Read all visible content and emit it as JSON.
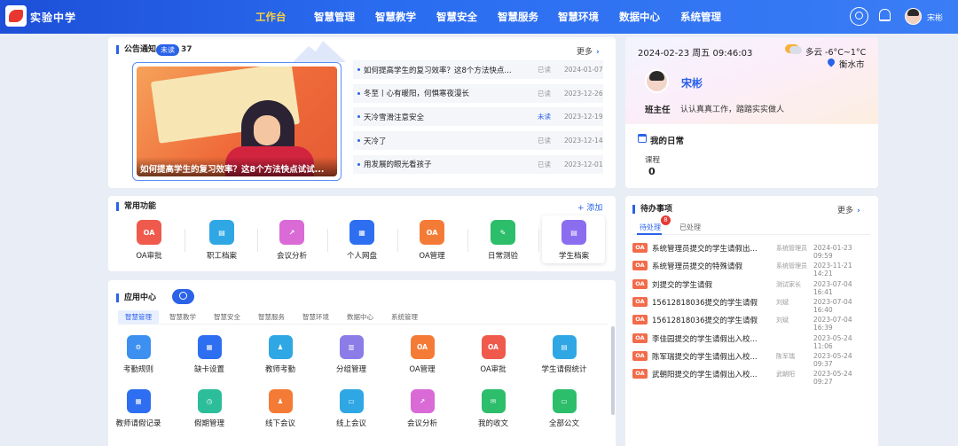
{
  "header": {
    "school": "实验中学",
    "nav": [
      "工作台",
      "智慧管理",
      "智慧教学",
      "智慧安全",
      "智慧服务",
      "智慧环境",
      "数据中心",
      "系统管理"
    ],
    "active_index": 0,
    "user": "宋彬"
  },
  "notice": {
    "title": "公告通知",
    "badge": "未读",
    "count": "37",
    "more": "更多",
    "banner_caption": "如何提高学生的复习效率？这8个方法快点试试...",
    "items": [
      {
        "title": "如何提高学生的复习效率？这8个方法快点...",
        "status": "已读",
        "date": "2024-01-07"
      },
      {
        "title": "冬至丨心有暖阳，何惧寒夜漫长",
        "status": "已读",
        "date": "2023-12-26"
      },
      {
        "title": "天冷雪滑注意安全",
        "status": "未读",
        "date": "2023-12-19"
      },
      {
        "title": "天冷了",
        "status": "已读",
        "date": "2023-12-14"
      },
      {
        "title": "用发展的眼光看孩子",
        "status": "已读",
        "date": "2023-12-01"
      }
    ]
  },
  "profile": {
    "datetime": "2024-02-23   周五   09:46:03",
    "weather": "多云   -6°C~1°C",
    "city": "衡水市",
    "name": "宋彬",
    "role": "班主任",
    "motto": "认认真真工作，踏踏实实做人",
    "daily_title": "我的日常",
    "course_label": "课程",
    "course_value": "0"
  },
  "common": {
    "title": "常用功能",
    "add": "+ 添加",
    "items": [
      {
        "label": "OA审批",
        "icon": "oa-approve-icon",
        "color": "#ef5a4c",
        "glyph": "OA"
      },
      {
        "label": "职工档案",
        "icon": "staff-file-icon",
        "color": "#2fa7e4",
        "glyph": "▤"
      },
      {
        "label": "会议分析",
        "icon": "meeting-analysis-icon",
        "color": "#d96ad6",
        "glyph": "↗"
      },
      {
        "label": "个人网盘",
        "icon": "cloud-disk-icon",
        "color": "#2d6ff0",
        "glyph": "▦"
      },
      {
        "label": "OA管理",
        "icon": "oa-manage-icon",
        "color": "#f47b36",
        "glyph": "OA"
      },
      {
        "label": "日常测验",
        "icon": "daily-test-icon",
        "color": "#2cbe6b",
        "glyph": "✎"
      },
      {
        "label": "学生档案",
        "icon": "student-file-icon",
        "color": "#8b6ef0",
        "glyph": "▤"
      }
    ]
  },
  "apps": {
    "title": "应用中心",
    "categories": [
      "智慧管理",
      "智慧教学",
      "智慧安全",
      "智慧服务",
      "智慧环境",
      "数据中心",
      "系统管理"
    ],
    "active_category": 0,
    "row1": [
      {
        "label": "考勤规则",
        "icon": "attendance-rule-icon",
        "color": "#3d8ff0",
        "glyph": "⚙"
      },
      {
        "label": "缺卡设置",
        "icon": "missing-card-icon",
        "color": "#2d6ff0",
        "glyph": "▦"
      },
      {
        "label": "教师考勤",
        "icon": "teacher-attendance-icon",
        "color": "#2fa7e4",
        "glyph": "♟"
      },
      {
        "label": "分组管理",
        "icon": "group-manage-icon",
        "color": "#8b7ce8",
        "glyph": "▥"
      },
      {
        "label": "OA管理",
        "icon": "oa-manage-icon",
        "color": "#f47b36",
        "glyph": "OA"
      },
      {
        "label": "OA审批",
        "icon": "oa-approve-icon",
        "color": "#ef5a4c",
        "glyph": "OA"
      },
      {
        "label": "学生请假统计",
        "icon": "leave-stats-icon",
        "color": "#2fa7e4",
        "glyph": "▤"
      }
    ],
    "row2": [
      {
        "label": "教师请假记录",
        "icon": "teacher-leave-icon",
        "color": "#2d6ff0",
        "glyph": "▦"
      },
      {
        "label": "假期管理",
        "icon": "holiday-manage-icon",
        "color": "#2cbe9a",
        "glyph": "◷"
      },
      {
        "label": "线下会议",
        "icon": "offline-meeting-icon",
        "color": "#f47b36",
        "glyph": "♟"
      },
      {
        "label": "线上会议",
        "icon": "online-meeting-icon",
        "color": "#2fa7e4",
        "glyph": "▭"
      },
      {
        "label": "会议分析",
        "icon": "meeting-analysis-icon",
        "color": "#d96ad6",
        "glyph": "↗"
      },
      {
        "label": "我的收文",
        "icon": "my-docs-icon",
        "color": "#2cbe6b",
        "glyph": "✉"
      },
      {
        "label": "全部公文",
        "icon": "all-docs-icon",
        "color": "#2cbe6b",
        "glyph": "▭"
      }
    ]
  },
  "todo": {
    "title": "待办事项",
    "more": "更多",
    "tabs": [
      "待处理",
      "已处理"
    ],
    "badge": "8",
    "items": [
      {
        "title": "系统管理员提交的学生请假出...",
        "who": "系统管理员",
        "time": "2024-01-23 09:59"
      },
      {
        "title": "系统管理员提交的特殊请假",
        "who": "系统管理员",
        "time": "2023-11-21 14:21"
      },
      {
        "title": "刘提交的学生请假",
        "who": "测试家长",
        "time": "2023-07-04 16:41"
      },
      {
        "title": "15612818036提交的学生请假",
        "who": "刘斌",
        "time": "2023-07-04 16:40"
      },
      {
        "title": "15612818036提交的学生请假",
        "who": "刘斌",
        "time": "2023-07-04 16:39"
      },
      {
        "title": "李佳园提交的学生请假出入校...",
        "who": "",
        "time": "2023-05-24 11:06"
      },
      {
        "title": "陈军瑞提交的学生请假出入校...",
        "who": "陈军瑞",
        "time": "2023-05-24 09:37"
      },
      {
        "title": "武朝阳提交的学生请假出入校...",
        "who": "武朝阳",
        "time": "2023-05-24 09:27"
      }
    ]
  }
}
